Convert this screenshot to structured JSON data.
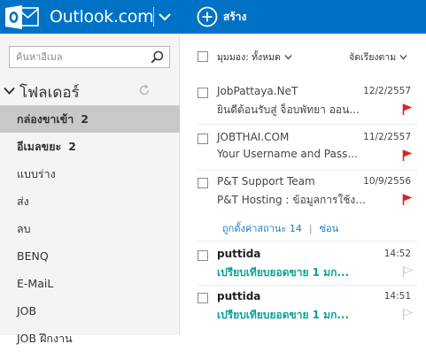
{
  "app": {
    "brand": "Outlook.com",
    "new_label": "สร้าง"
  },
  "sidebar": {
    "search_placeholder": "ค้นหาอีเมล",
    "folders_title": "โฟลเดอร์",
    "folders": [
      {
        "label": "กล่องขาเข้า",
        "count": "2",
        "selected": true
      },
      {
        "label": "อีเมลขยะ",
        "count": "2",
        "bold": true
      },
      {
        "label": "แบบร่าง"
      },
      {
        "label": "ส่ง"
      },
      {
        "label": "ลบ"
      },
      {
        "label": "BENQ"
      },
      {
        "label": "E-MaiL"
      },
      {
        "label": "JOB"
      },
      {
        "label": "JOB ฝึกงาน"
      }
    ]
  },
  "list_header": {
    "view_label": "มุมมอง: ทั้งหมด",
    "sort_label": "จัดเรียงตาม"
  },
  "messages": [
    {
      "sender": "JobPattaya.NeT",
      "date": "12/2/2557",
      "subject": "ยินดีต้อนรับสู่ จ็อบพัทยา ออน...",
      "flagged": true,
      "unread": false
    },
    {
      "sender": "JOBTHAI.COM",
      "date": "11/2/2557",
      "subject": "Your Username and Pass...",
      "flagged": true,
      "unread": false
    },
    {
      "sender": "P&T Support Team",
      "date": "10/9/2556",
      "subject": "P&T Hosting : ข้อมูลการใช้ง...",
      "flagged": true,
      "unread": false
    },
    {
      "sender": "puttida",
      "date": "14:52",
      "subject": "เปรียบเทียบยอดขาย 1 มก...",
      "flagged": false,
      "unread": true
    },
    {
      "sender": "puttida",
      "date": "14:51",
      "subject": "เปรียบเทียบยอดขาย 1 มก...",
      "flagged": false,
      "unread": true
    }
  ],
  "thread": {
    "status_text": "ถูกตั้งค่าสถานะ 14",
    "separator": "|",
    "hide_label": "ซ่อน"
  },
  "colors": {
    "topbar": "#0072c6",
    "flag": "#d9232d",
    "unread_subject": "#0ba19a",
    "link": "#1a7fc4"
  }
}
